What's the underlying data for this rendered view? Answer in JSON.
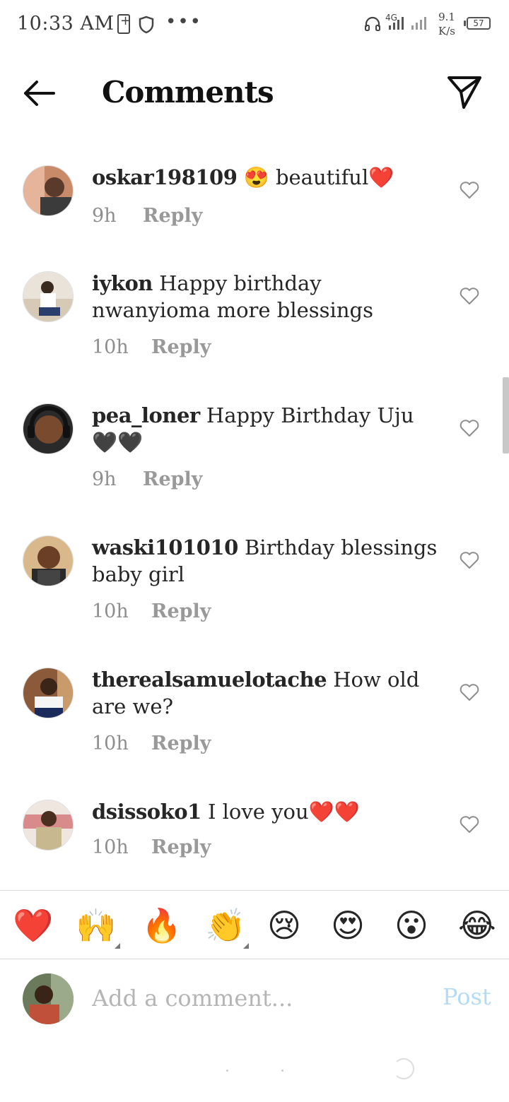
{
  "status_bar": {
    "time": "10:33 AM",
    "network": "4G",
    "speed_value": "9.1",
    "speed_unit": "K/s",
    "battery": "57"
  },
  "header": {
    "title": "Comments"
  },
  "comments": [
    {
      "username": "oskar198109",
      "text": " 😍 beautiful❤️",
      "time": "9h",
      "reply": "Reply"
    },
    {
      "username": "iykon",
      "text": " Happy birthday nwanyioma more blessings",
      "time": "10h",
      "reply": "Reply"
    },
    {
      "username": "pea_loner",
      "text": " Happy Birthday Uju 🖤🖤",
      "time": "9h",
      "reply": "Reply"
    },
    {
      "username": "waski101010",
      "text": " Birthday blessings baby girl",
      "time": "10h",
      "reply": "Reply"
    },
    {
      "username": "therealsamuelotache",
      "text": " How old are we?",
      "time": "10h",
      "reply": "Reply"
    },
    {
      "username": "dsissoko1",
      "text": " I love you❤️❤️",
      "time": "10h",
      "reply": "Reply"
    }
  ],
  "emoji_bar": [
    "❤️",
    "🙌",
    "🔥",
    "👏",
    "😢",
    "😍",
    "😮",
    "😂"
  ],
  "composer": {
    "placeholder": "Add a comment...",
    "post_label": "Post"
  },
  "colors": {
    "text": "#262626",
    "secondary": "#8e8e8e",
    "post_disabled": "#b3dbf8",
    "divider": "#dbdbdb"
  },
  "icons": {
    "back": "arrow-left-icon",
    "share": "paper-plane-icon",
    "like": "heart-outline-icon"
  }
}
